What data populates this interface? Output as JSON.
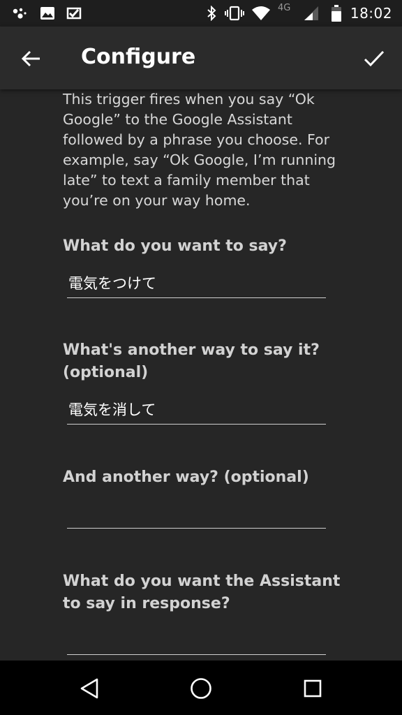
{
  "status_bar": {
    "time": "18:02",
    "network": "4G",
    "icons": [
      "google-assistant-icon",
      "image-icon",
      "checkmark-badge-icon",
      "bluetooth-icon",
      "vibrate-icon",
      "wifi-icon",
      "signal-icon",
      "battery-icon"
    ]
  },
  "app_bar": {
    "title": "Configure",
    "back_icon": "arrow-left-icon",
    "confirm_icon": "check-icon"
  },
  "form": {
    "description": "This trigger fires when you say “Ok Google” to the Google Assistant followed by a phrase you choose. For example, say “Ok Google, I’m running late” to text a family member that you’re on your way home.",
    "fields": [
      {
        "label": "What do you want to say?",
        "value": "電気をつけて"
      },
      {
        "label": "What's another way to say it? (optional)",
        "value": "電気を消して"
      },
      {
        "label": "And another way? (optional)",
        "value": ""
      },
      {
        "label": "What do you want the Assistant to say in response?",
        "value": ""
      }
    ]
  },
  "nav_bar": {
    "buttons": [
      "back-triangle-icon",
      "home-circle-icon",
      "recents-square-icon"
    ]
  },
  "colors": {
    "background": "#262626",
    "app_bar": "#2b2b2b",
    "status_bar": "#1e1e1e",
    "nav_bar": "#000000",
    "text": "#d8d8d8"
  }
}
